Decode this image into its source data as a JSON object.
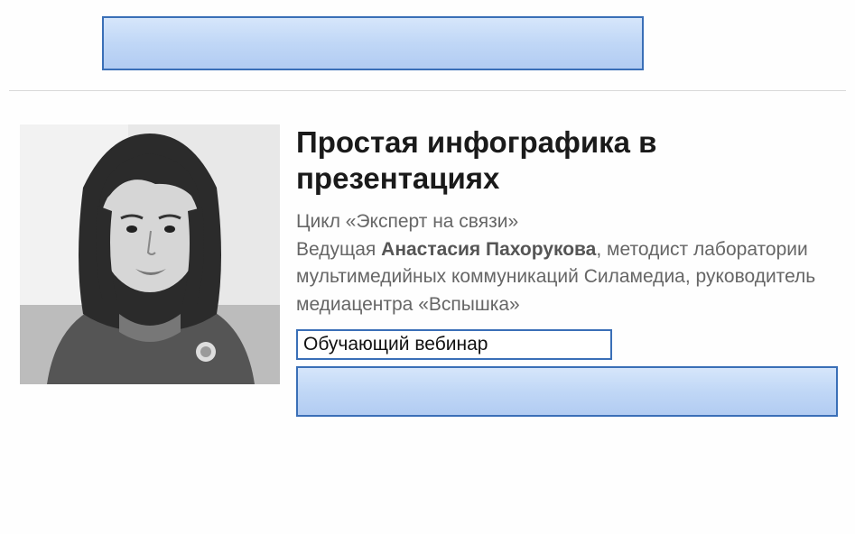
{
  "header": {
    "top_box_label": ""
  },
  "article": {
    "title": "Простая инфографика в презентациях",
    "series": "Цикл «Эксперт на связи»",
    "presenter_prefix": "Ведущая ",
    "presenter_name": "Анастасия Пахорукова",
    "presenter_role": ", методист лаборатории мультимедийных коммуникаций Силамедиа, руководитель медиацентра «Вспышка»",
    "tag": "Обучающий вебинар",
    "cta_label": ""
  },
  "photo": {
    "alt": "presenter-portrait"
  }
}
